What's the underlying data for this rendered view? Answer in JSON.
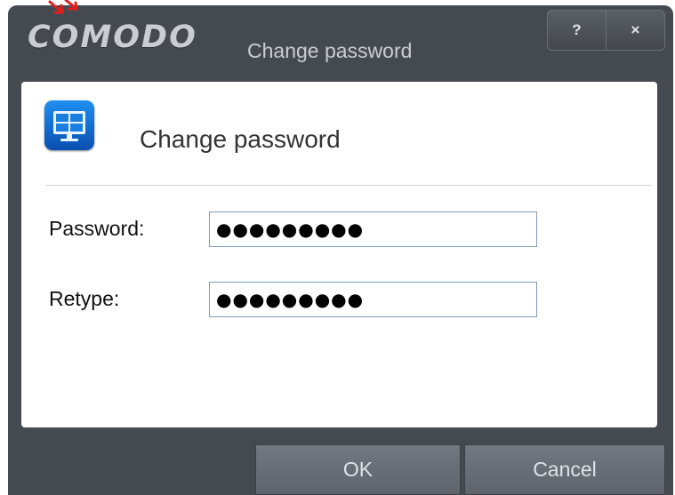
{
  "window": {
    "brand": "COMODO",
    "title": "Change password",
    "help_glyph": "?",
    "close_glyph": "×"
  },
  "header": {
    "icon": "monitor-icon",
    "title": "Change password"
  },
  "form": {
    "password_label": "Password:",
    "password_value": "●●●●●●●●●",
    "retype_label": "Retype:",
    "retype_value": "●●●●●●●●●"
  },
  "footer": {
    "ok_label": "OK",
    "cancel_label": "Cancel"
  },
  "colors": {
    "frame": "#454a51",
    "accent_icon": "#1a7fe0",
    "annotation_arrow": "#e81b1b"
  }
}
